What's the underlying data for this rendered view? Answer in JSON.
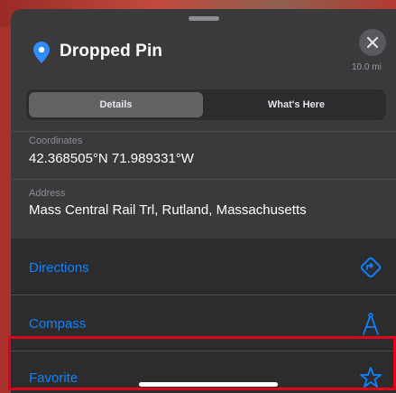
{
  "header": {
    "title": "Dropped Pin",
    "distance": "10.0 mi"
  },
  "tabs": [
    {
      "label": "Details",
      "selected": true
    },
    {
      "label": "What's Here",
      "selected": false
    }
  ],
  "coordinates": {
    "label": "Coordinates",
    "value": "42.368505°N 71.989331°W"
  },
  "address": {
    "label": "Address",
    "value": "Mass Central Rail Trl, Rutland, Massachusetts"
  },
  "actions": [
    {
      "label": "Directions",
      "icon": "directions-icon"
    },
    {
      "label": "Compass",
      "icon": "compass-icon"
    },
    {
      "label": "Favorite",
      "icon": "star-icon"
    }
  ],
  "colors": {
    "accent": "#0a84ff",
    "sheet": "#3a3a3c",
    "highlight": "#e0001a"
  }
}
